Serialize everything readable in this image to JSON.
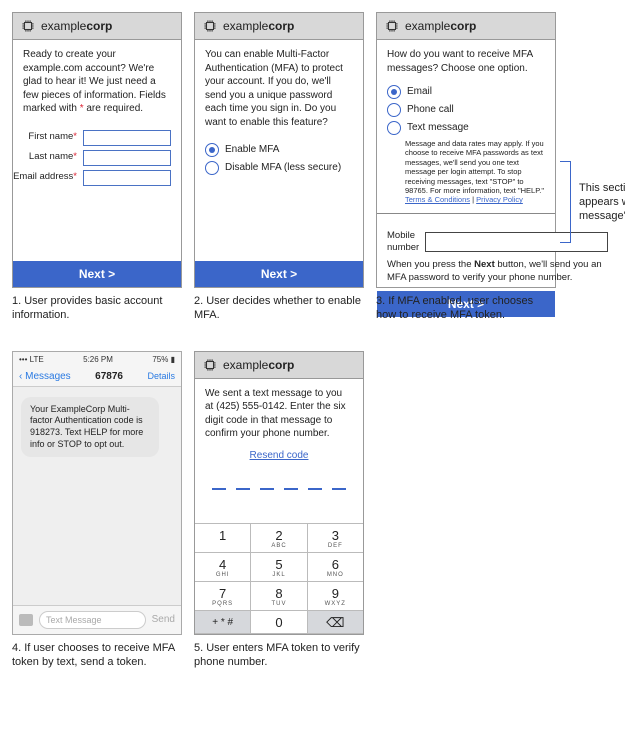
{
  "brand": {
    "part1": "example",
    "part2": "corp"
  },
  "step1": {
    "intro": "Ready to create your example.com account? We're glad to hear it! We just need a few pieces of information. Fields marked with * are required.",
    "first_name": "First name",
    "last_name": "Last name",
    "email": "Email address",
    "next": "Next >",
    "caption": "1. User provides basic account information."
  },
  "step2": {
    "intro": "You can enable Multi-Factor Authentication (MFA) to protect your account. If you do, we'll send you a unique password each time you sign in. Do you want to enable this feature?",
    "enable": "Enable MFA",
    "disable": "Disable MFA (less secure)",
    "next": "Next >",
    "caption": "2. User decides whether to enable MFA."
  },
  "step3": {
    "intro": "How do you want to receive MFA messages? Choose one option.",
    "opt_email": "Email",
    "opt_phone": "Phone call",
    "opt_text": "Text message",
    "fineprint": "Message and data rates may apply. If you choose to receive MFA passwords as text messages, we'll send you one text message per login attempt. To stop receiving messages, text \"STOP\" to 98765. For more information, text \"HELP.\"",
    "terms": "Terms & Conditions",
    "privacy": "Privacy Policy",
    "mobile_label": "Mobile number",
    "after_press_1": "When you press the ",
    "after_press_bold": "Next",
    "after_press_2": " button, we'll send you an MFA password to verify your phone number.",
    "next": "Next >",
    "caption": "3. If MFA enabled, user chooses how to receive MFA token.",
    "annotation": "This section only appears when 'Text message' is selected"
  },
  "step4": {
    "status_left": "•••   LTE",
    "status_time": "5:26 PM",
    "status_right": "75% ▮",
    "back": "Messages",
    "title": "67876",
    "details": "Details",
    "bubble": "Your ExampleCorp Multi-factor Authentication code is 918273. Text HELP for more info or STOP to opt out.",
    "placeholder": "Text Message",
    "send": "Send",
    "caption": "4. If user chooses to receive MFA token by text, send a token."
  },
  "step5": {
    "intro": "We sent a text message to you at (425) 555-0142. Enter the six digit code in that message to confirm your phone number.",
    "resend": "Resend code",
    "keys": {
      "k1n": "1",
      "k1l": "",
      "k2n": "2",
      "k2l": "ABC",
      "k3n": "3",
      "k3l": "DEF",
      "k4n": "4",
      "k4l": "GHI",
      "k5n": "5",
      "k5l": "JKL",
      "k6n": "6",
      "k6l": "MNO",
      "k7n": "7",
      "k7l": "PQRS",
      "k8n": "8",
      "k8l": "TUV",
      "k9n": "9",
      "k9l": "WXYZ",
      "ksym": "+ * #",
      "k0n": "0",
      "kback": "⌫"
    },
    "caption": "5. User enters MFA token to verify phone number."
  }
}
